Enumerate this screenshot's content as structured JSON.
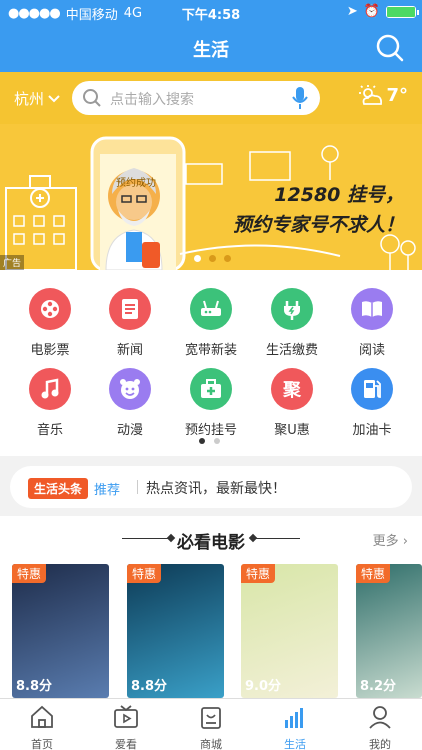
{
  "status": {
    "carrier": "中国移动",
    "network": "4G",
    "time": "下午4:58"
  },
  "nav": {
    "title": "生活"
  },
  "search": {
    "city": "杭州",
    "placeholder": "点击输入搜索",
    "temperature": "7°"
  },
  "banner": {
    "line1": "12580 挂号，",
    "line2": "预约专家号不求人！",
    "badge": "预约成功",
    "ad_label": "广告",
    "page": 1,
    "pages": 3
  },
  "services": [
    {
      "label": "电影票",
      "icon": "film-reel-icon",
      "color": "#f0585b"
    },
    {
      "label": "新闻",
      "icon": "document-icon",
      "color": "#f0585b"
    },
    {
      "label": "宽带新装",
      "icon": "router-icon",
      "color": "#3cc27a"
    },
    {
      "label": "生活缴费",
      "icon": "plug-icon",
      "color": "#3cc27a"
    },
    {
      "label": "阅读",
      "icon": "book-icon",
      "color": "#9a7cf0"
    },
    {
      "label": "音乐",
      "icon": "music-note-icon",
      "color": "#f0585b"
    },
    {
      "label": "动漫",
      "icon": "smiley-face-icon",
      "color": "#9a7cf0"
    },
    {
      "label": "预约挂号",
      "icon": "medical-kit-icon",
      "color": "#3cc27a"
    },
    {
      "label": "聚U惠",
      "icon": "ju-text-icon",
      "icon_text": "聚",
      "color": "#f0585b"
    },
    {
      "label": "加油卡",
      "icon": "fuel-pump-icon",
      "color": "#3a8ef0"
    }
  ],
  "news": {
    "tag": "生活头条",
    "recommend": "推荐",
    "text": "热点资讯，最新最快！"
  },
  "movies": {
    "title": "必看电影",
    "more": "更多",
    "items": [
      {
        "tag": "特惠",
        "score": "8.8分",
        "colors": [
          "#1e2c4a",
          "#5a7db0"
        ]
      },
      {
        "tag": "特惠",
        "score": "8.8分",
        "colors": [
          "#0d3a55",
          "#3aa0c8"
        ]
      },
      {
        "tag": "特惠",
        "score": "9.0分",
        "colors": [
          "#d8e6a8",
          "#f3f0d8"
        ]
      },
      {
        "tag": "特惠",
        "score": "8.2分",
        "colors": [
          "#2f6e6a",
          "#c9dcd0"
        ]
      }
    ]
  },
  "tabs": [
    {
      "label": "首页",
      "icon": "home-icon"
    },
    {
      "label": "爱看",
      "icon": "video-play-icon"
    },
    {
      "label": "商城",
      "icon": "shopping-bag-icon"
    },
    {
      "label": "生活",
      "icon": "signal-bars-icon",
      "active": true
    },
    {
      "label": "我的",
      "icon": "user-icon"
    }
  ],
  "colors": {
    "primary": "#3a9bf0",
    "yellow": "#f5c431",
    "accent": "#f05a28"
  }
}
